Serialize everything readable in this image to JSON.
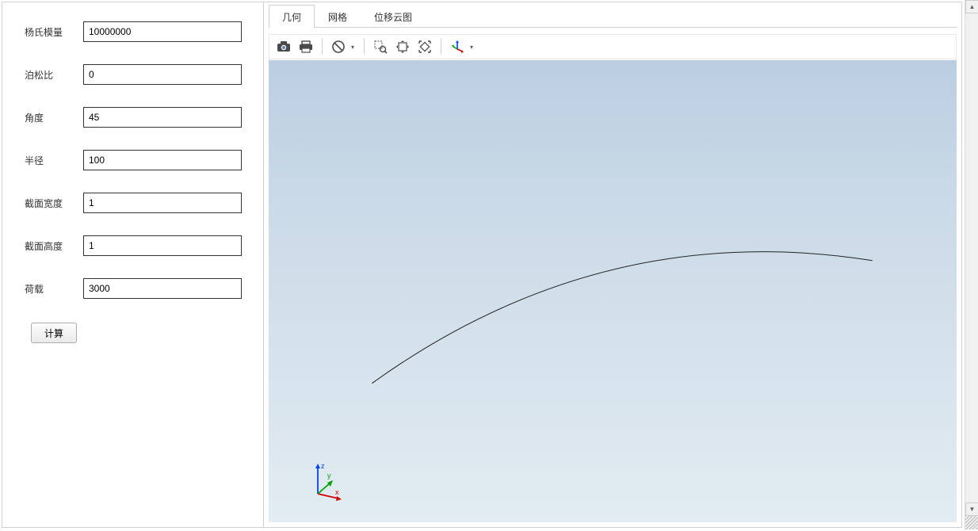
{
  "form": {
    "fields": [
      {
        "label": "杨氏模量",
        "value": "10000000"
      },
      {
        "label": "泊松比",
        "value": "0"
      },
      {
        "label": "角度",
        "value": "45"
      },
      {
        "label": "半径",
        "value": "100"
      },
      {
        "label": "截面宽度",
        "value": "1"
      },
      {
        "label": "截面高度",
        "value": "1"
      },
      {
        "label": "荷载",
        "value": "3000"
      }
    ],
    "calc_label": "计算"
  },
  "tabs": [
    {
      "label": "几何",
      "active": true
    },
    {
      "label": "网格",
      "active": false
    },
    {
      "label": "位移云图",
      "active": false
    }
  ],
  "toolbar": {
    "icons": [
      "camera-icon",
      "print-icon",
      "sep",
      "reset-view-icon",
      "dd",
      "sep",
      "zoom-box-icon",
      "pan-icon",
      "fit-icon",
      "sep",
      "axis-icon",
      "dd"
    ]
  },
  "triad": {
    "x": "x",
    "y": "y",
    "z": "z"
  }
}
